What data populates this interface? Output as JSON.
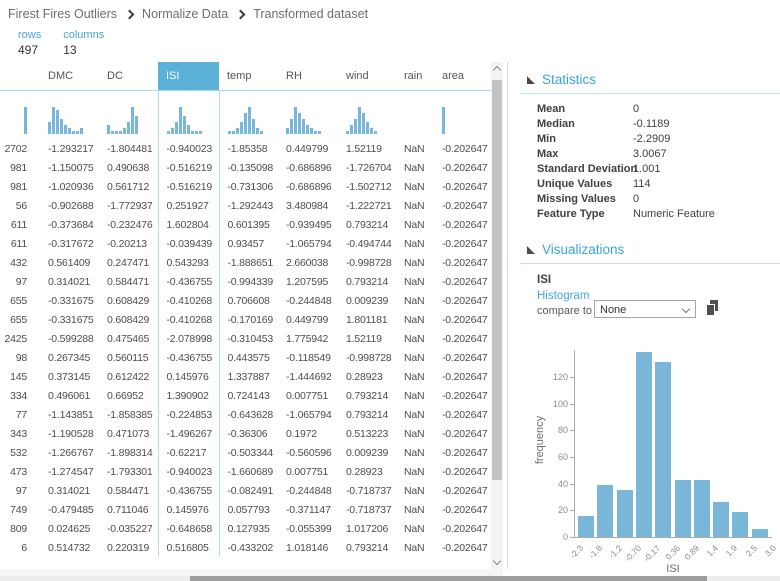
{
  "breadcrumb": {
    "items": [
      "Firest Fires Outliers",
      "Normalize Data",
      "Transformed dataset"
    ]
  },
  "meta": {
    "rows_label": "rows",
    "rows_value": "497",
    "columns_label": "columns",
    "columns_value": "13"
  },
  "table": {
    "selected_column": "ISI",
    "columns": [
      {
        "label": "",
        "clipped": true,
        "spark": [
          9
        ]
      },
      {
        "label": "DMC",
        "spark": [
          4,
          9,
          8,
          5,
          3,
          2,
          1,
          1,
          2
        ]
      },
      {
        "label": "DC",
        "spark": [
          3,
          1,
          1,
          1,
          2,
          4,
          9,
          6
        ]
      },
      {
        "label": "ISI",
        "selected": true,
        "spark": [
          1,
          2,
          4,
          9,
          6,
          3,
          1,
          1,
          1
        ]
      },
      {
        "label": "temp",
        "spark": [
          1,
          1,
          2,
          4,
          7,
          9,
          5,
          2,
          1
        ]
      },
      {
        "label": "RH",
        "spark": [
          2,
          5,
          9,
          7,
          5,
          3,
          2,
          1,
          1
        ]
      },
      {
        "label": "wind",
        "spark": [
          1,
          3,
          5,
          9,
          7,
          4,
          2,
          1
        ]
      },
      {
        "label": "rain",
        "spark": []
      },
      {
        "label": "area",
        "spark": [
          9
        ]
      }
    ],
    "rows": [
      [
        "2702",
        "-1.293217",
        "-1.804481",
        "-0.940023",
        "-1.85358",
        "0.449799",
        "1.52119",
        "NaN",
        "-0.202647"
      ],
      [
        "981",
        "-1.150075",
        "0.490638",
        "-0.516219",
        "-0.135098",
        "-0.686896",
        "-1.726704",
        "NaN",
        "-0.202647"
      ],
      [
        "981",
        "-1.020936",
        "0.561712",
        "-0.516219",
        "-0.731306",
        "-0.686896",
        "-1.502712",
        "NaN",
        "-0.202647"
      ],
      [
        "56",
        "-0.902688",
        "-1.772937",
        "0.251927",
        "-1.292443",
        "3.480984",
        "-1.222721",
        "NaN",
        "-0.202647"
      ],
      [
        "611",
        "-0.373684",
        "-0.232476",
        "1.602804",
        "0.601395",
        "-0.939495",
        "0.793214",
        "NaN",
        "-0.202647"
      ],
      [
        "611",
        "-0.317672",
        "-0.20213",
        "-0.039439",
        "0.93457",
        "-1.065794",
        "-0.494744",
        "NaN",
        "-0.202647"
      ],
      [
        "432",
        "0.561409",
        "0.247471",
        "0.543293",
        "-1.888651",
        "2.660038",
        "-0.998728",
        "NaN",
        "-0.202647"
      ],
      [
        "97",
        "0.314021",
        "0.584471",
        "-0.436755",
        "-0.994339",
        "1.207595",
        "0.793214",
        "NaN",
        "-0.202647"
      ],
      [
        "655",
        "-0.331675",
        "0.608429",
        "-0.410268",
        "0.706608",
        "-0.244848",
        "0.009239",
        "NaN",
        "-0.202647"
      ],
      [
        "655",
        "-0.331675",
        "0.608429",
        "-0.410268",
        "-0.170169",
        "0.449799",
        "1.801181",
        "NaN",
        "-0.202647"
      ],
      [
        "2425",
        "-0.599288",
        "0.475465",
        "-2.078998",
        "-0.310453",
        "1.775942",
        "1.52119",
        "NaN",
        "-0.202647"
      ],
      [
        "98",
        "0.267345",
        "0.560115",
        "-0.436755",
        "0.443575",
        "-0.118549",
        "-0.998728",
        "NaN",
        "-0.202647"
      ],
      [
        "145",
        "0.373145",
        "0.612422",
        "0.145976",
        "1.337887",
        "-1.444692",
        "0.28923",
        "NaN",
        "-0.202647"
      ],
      [
        "334",
        "0.496061",
        "0.66952",
        "1.390902",
        "0.724143",
        "0.007751",
        "0.793214",
        "NaN",
        "-0.202647"
      ],
      [
        "77",
        "-1.143851",
        "-1.858385",
        "-0.224853",
        "-0.643628",
        "-1.065794",
        "0.793214",
        "NaN",
        "-0.202647"
      ],
      [
        "343",
        "-1.190528",
        "0.471073",
        "-1.496267",
        "-0.36306",
        "0.1972",
        "0.513223",
        "NaN",
        "-0.202647"
      ],
      [
        "532",
        "-1.266767",
        "-1.898314",
        "-0.62217",
        "-0.503344",
        "-0.560596",
        "0.009239",
        "NaN",
        "-0.202647"
      ],
      [
        "473",
        "-1.274547",
        "-1.793301",
        "-0.940023",
        "-1.660689",
        "0.007751",
        "0.28923",
        "NaN",
        "-0.202647"
      ],
      [
        "97",
        "0.314021",
        "0.584471",
        "-0.436755",
        "-0.082491",
        "-0.244848",
        "-0.718737",
        "NaN",
        "-0.202647"
      ],
      [
        "749",
        "-0.479485",
        "0.711046",
        "0.145976",
        "0.057793",
        "-0.371147",
        "-0.718737",
        "NaN",
        "-0.202647"
      ],
      [
        "809",
        "0.024625",
        "-0.035227",
        "-0.648658",
        "0.127935",
        "-0.055399",
        "1.017206",
        "NaN",
        "-0.202647"
      ],
      [
        "6",
        "0.514732",
        "0.220319",
        "0.516805",
        "-0.433202",
        "1.018146",
        "0.793214",
        "NaN",
        "-0.202647"
      ]
    ]
  },
  "statistics": {
    "title": "Statistics",
    "items": [
      {
        "label": "Mean",
        "value": "0"
      },
      {
        "label": "Median",
        "value": "-0.1189"
      },
      {
        "label": "Min",
        "value": "-2.2909"
      },
      {
        "label": "Max",
        "value": "3.0067"
      },
      {
        "label": "Standard Deviation",
        "value": "1.001"
      },
      {
        "label": "Unique Values",
        "value": "114"
      },
      {
        "label": "Missing Values",
        "value": "0"
      },
      {
        "label": "Feature Type",
        "value": "Numeric Feature"
      }
    ]
  },
  "visualizations": {
    "title": "Visualizations",
    "feature": "ISI",
    "chart_type_label": "Histogram",
    "compare_label": "compare to",
    "compare_value": "None"
  },
  "icons": {
    "collapse_triangle": "triangle-lower-left",
    "chevron_up": "chevron-up",
    "chevron_down": "chevron-down",
    "copy": "copy-pages"
  },
  "chart_data": {
    "type": "bar",
    "title": "ISI histogram",
    "xlabel": "ISI",
    "ylabel": "frequency",
    "bin_edges": [
      "-2.3",
      "-1.8",
      "-1.2",
      "-0.70",
      "-0.17",
      "0.36",
      "0.89",
      "1.4",
      "1.9",
      "2.5",
      "3.0"
    ],
    "values": [
      16,
      39,
      35,
      139,
      131,
      43,
      43,
      26,
      19,
      6
    ],
    "yticks": [
      0,
      20,
      40,
      60,
      80,
      100,
      120
    ],
    "ylim": [
      0,
      140
    ],
    "grid": false,
    "legend": "none",
    "bar_color": "#79b6d7"
  }
}
